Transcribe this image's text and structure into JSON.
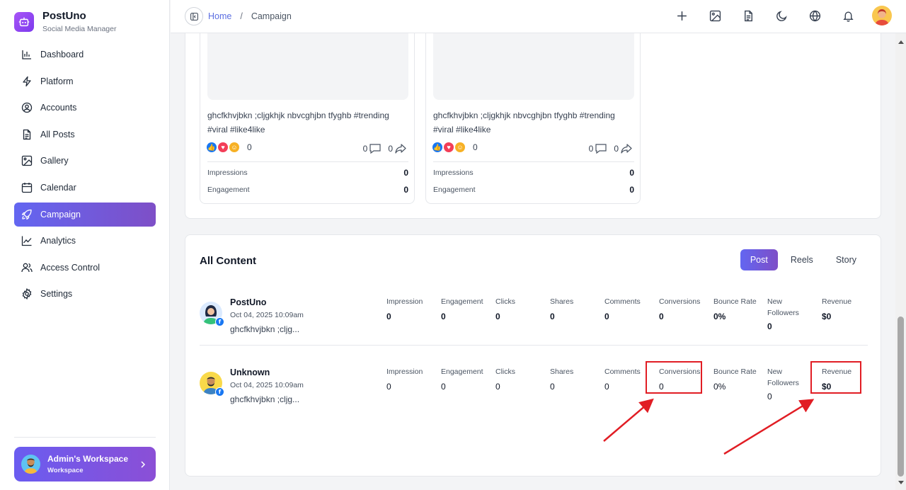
{
  "brand": {
    "name": "PostUno",
    "subtitle": "Social Media Manager"
  },
  "nav": [
    {
      "id": "dashboard",
      "label": "Dashboard",
      "icon": "bar-chart-icon"
    },
    {
      "id": "platform",
      "label": "Platform",
      "icon": "lightning-icon"
    },
    {
      "id": "accounts",
      "label": "Accounts",
      "icon": "user-circle-icon"
    },
    {
      "id": "all-posts",
      "label": "All Posts",
      "icon": "document-icon"
    },
    {
      "id": "gallery",
      "label": "Gallery",
      "icon": "image-icon"
    },
    {
      "id": "calendar",
      "label": "Calendar",
      "icon": "calendar-icon"
    },
    {
      "id": "campaign",
      "label": "Campaign",
      "icon": "rocket-icon",
      "active": true
    },
    {
      "id": "analytics",
      "label": "Analytics",
      "icon": "line-chart-icon"
    },
    {
      "id": "access-control",
      "label": "Access Control",
      "icon": "users-icon"
    },
    {
      "id": "settings",
      "label": "Settings",
      "icon": "gear-icon"
    }
  ],
  "workspace": {
    "name": "Admin's Workspace",
    "subtitle": "Workspace"
  },
  "breadcrumb": {
    "home": "Home",
    "separator": "/",
    "current": "Campaign"
  },
  "header_icons": [
    "plus-icon",
    "image-icon",
    "document-icon",
    "moon-icon",
    "globe-icon",
    "bell-icon"
  ],
  "posts": [
    {
      "caption": "ghcfkhvjbkn ;cljgkhjk nbvcghjbn tfyghb #trending #viral #like4like",
      "reactions": "0",
      "comments": "0",
      "shares": "0",
      "metrics": [
        {
          "label": "Impressions",
          "value": "0"
        },
        {
          "label": "Engagement",
          "value": "0"
        }
      ]
    },
    {
      "caption": "ghcfkhvjbkn ;cljgkhjk nbvcghjbn tfyghb #trending #viral #like4like",
      "reactions": "0",
      "comments": "0",
      "shares": "0",
      "metrics": [
        {
          "label": "Impressions",
          "value": "0"
        },
        {
          "label": "Engagement",
          "value": "0"
        }
      ]
    }
  ],
  "all_content": {
    "title": "All Content",
    "tabs": [
      {
        "label": "Post",
        "active": true
      },
      {
        "label": "Reels"
      },
      {
        "label": "Story"
      }
    ],
    "columns": [
      "Impression",
      "Engagement",
      "Clicks",
      "Shares",
      "Comments",
      "Conversions",
      "Bounce Rate",
      "New Followers",
      "Revenue"
    ],
    "rows": [
      {
        "name": "PostUno",
        "date": "Oct 04, 2025 10:09am",
        "caption": "ghcfkhvjbkn ;cljg...",
        "values": [
          "0",
          "0",
          "0",
          "0",
          "0",
          "0",
          "0%",
          "0",
          "$0"
        ]
      },
      {
        "name": "Unknown",
        "date": "Oct 04, 2025 10:09am",
        "caption": "ghcfkhvjbkn ;cljg...",
        "values": [
          "0",
          "0",
          "0",
          "0",
          "0",
          "0",
          "0%",
          "0",
          "$0"
        ]
      }
    ]
  },
  "colors": {
    "accent": "#6366f1",
    "accent_end": "#7e4fc7",
    "annotation": "#e11d24",
    "facebook": "#1877f2"
  }
}
